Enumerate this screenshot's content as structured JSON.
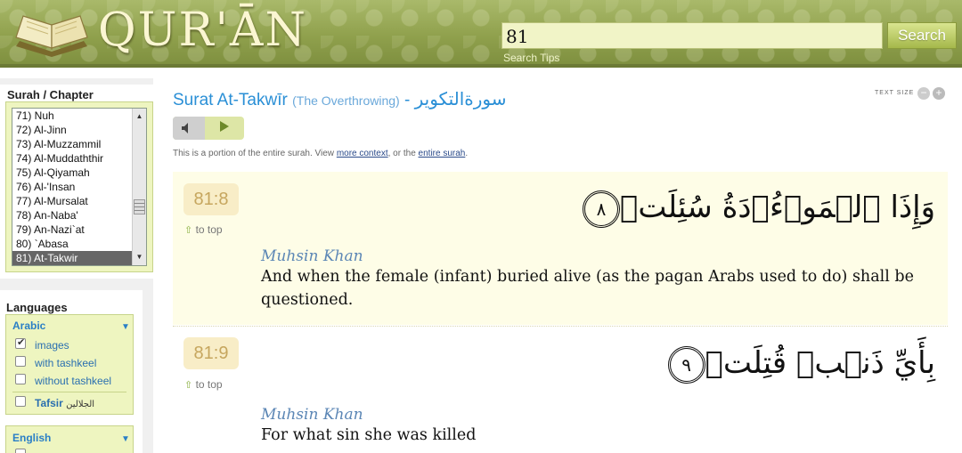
{
  "header": {
    "logo_text": "QUR'ĀN",
    "search_value": "81",
    "search_button": "Search",
    "search_tips": "Search Tips"
  },
  "sidebar": {
    "chapter_title": "Surah / Chapter",
    "chapters": [
      "71) Nuh",
      "72) Al-Jinn",
      "73) Al-Muzzammil",
      "74) Al-Muddaththir",
      "75) Al-Qiyamah",
      "76) Al-'Insan",
      "77) Al-Mursalat",
      "78) An-Naba'",
      "79) An-Nazi`at",
      "80) `Abasa",
      "81) At-Takwir"
    ],
    "selected_chapter": "81) At-Takwir",
    "languages_title": "Languages",
    "arabic": {
      "label": "Arabic",
      "options": [
        "images",
        "with tashkeel",
        "without tashkeel"
      ],
      "checked": [
        true,
        false,
        false
      ],
      "tafsir_label": "Tafsir",
      "tafsir_ar": "الجلالين"
    },
    "english": {
      "label": "English"
    }
  },
  "main": {
    "title": "Surat At-Takwīr",
    "title_sub": "(The Overthrowing)",
    "title_sep": "-",
    "title_ar": "سورةالتكوير",
    "text_size_label": "TEXT SIZE",
    "portion_prefix": "This is a portion of the entire surah. View",
    "more_context": "more context",
    "portion_mid": ", or the",
    "entire_surah": "entire surah",
    "portion_suffix": ".",
    "to_top": "to top",
    "verses": [
      {
        "ref": "81:8",
        "arabic": "وَإِذَا ٱلۡمَوۡءُۥدَةُ سُئِلَتۡ",
        "ayah_number": "٨",
        "translator": "Muhsin Khan",
        "translation": "And when the female (infant) buried alive (as the pagan Arabs used to do) shall be questioned."
      },
      {
        "ref": "81:9",
        "arabic": "بِأَيِّ ذَنۢبٖ قُتِلَتۡ",
        "ayah_number": "٩",
        "translator": "Muhsin Khan",
        "translation": "For what sin she was killed"
      }
    ]
  }
}
